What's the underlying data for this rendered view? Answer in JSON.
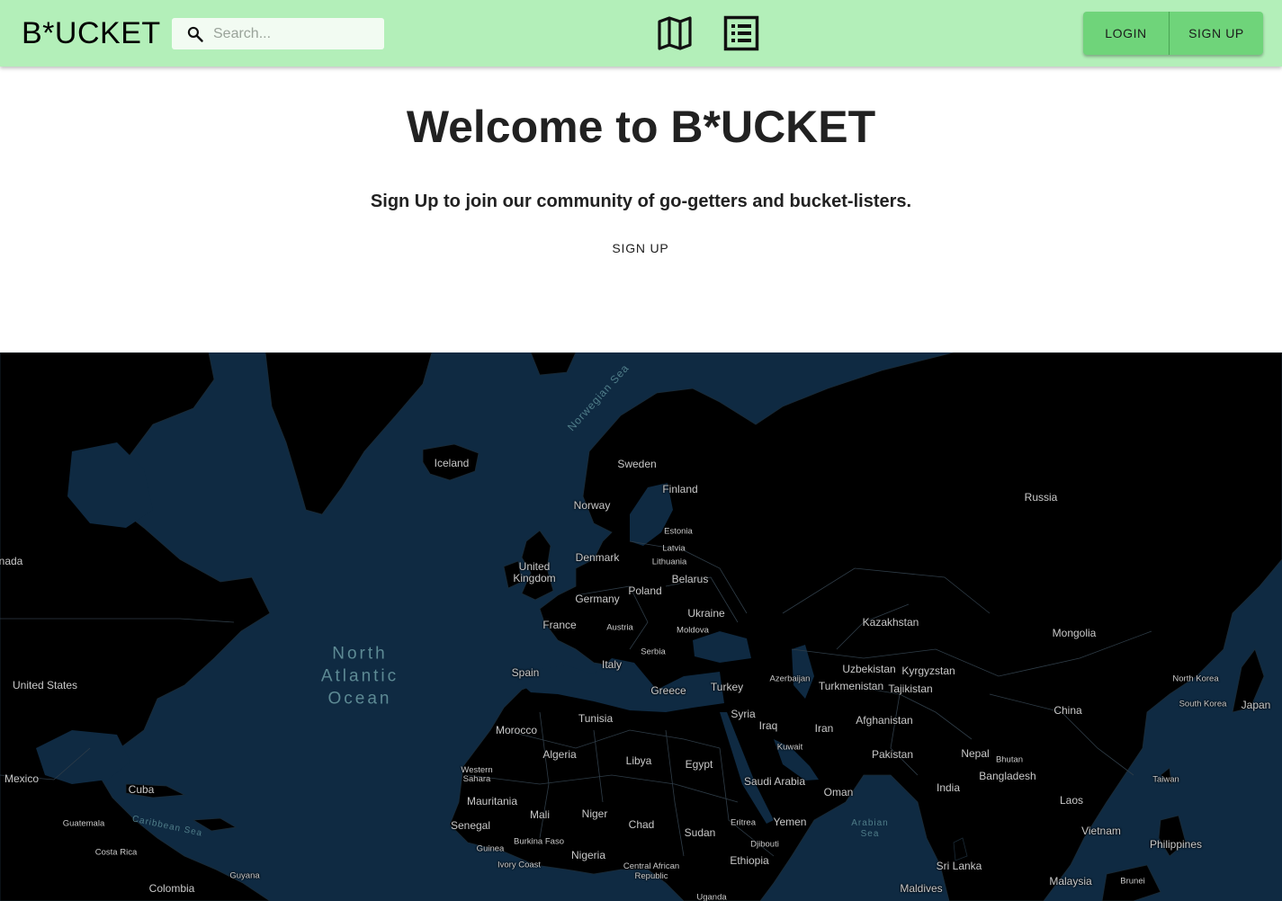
{
  "header": {
    "brand": "B*UCKET",
    "search": {
      "placeholder": "Search..."
    },
    "nav_icons": [
      "map-icon",
      "list-icon"
    ],
    "auth": {
      "login_label": "LOGIN",
      "signup_label": "SIGN UP"
    }
  },
  "hero": {
    "title": "Welcome to B*UCKET",
    "subtitle": "Sign Up to join our community of go-getters and bucket-listers.",
    "cta_label": "SIGN UP"
  },
  "map": {
    "oceans": {
      "north_atlantic": [
        "North",
        "Atlantic",
        "Ocean"
      ],
      "norwegian_sea": "Norwegian Sea",
      "caribbean_sea": "Caribbean Sea",
      "arabian_sea": [
        "Arabian",
        "Sea"
      ]
    },
    "countries": {
      "iceland": "Iceland",
      "sweden": "Sweden",
      "finland": "Finland",
      "norway": "Norway",
      "russia": "Russia",
      "estonia": "Estonia",
      "latvia": "Latvia",
      "lithuania": "Lithuania",
      "denmark": "Denmark",
      "uk": [
        "United",
        "Kingdom"
      ],
      "belarus": "Belarus",
      "poland": "Poland",
      "germany": "Germany",
      "canada": "nada",
      "ukraine": "Ukraine",
      "kazakhstan": "Kazakhstan",
      "mongolia": "Mongolia",
      "france": "France",
      "austria": "Austria",
      "moldova": "Moldova",
      "serbia": "Serbia",
      "italy": "Italy",
      "spain": "Spain",
      "greece": "Greece",
      "turkey": "Turkey",
      "azerbaijan": "Azerbaijan",
      "uzbekistan": "Uzbekistan",
      "kyrgyzstan": "Kyrgyzstan",
      "turkmenistan": "Turkmenistan",
      "tajikistan": "Tajikistan",
      "north_korea": "North Korea",
      "south_korea": "South Korea",
      "japan": "Japan",
      "united_states": "United States",
      "china": "China",
      "afghanistan": "Afghanistan",
      "syria": "Syria",
      "tunisia": "Tunisia",
      "iraq": "Iraq",
      "iran": "Iran",
      "morocco": "Morocco",
      "kuwait": "Kuwait",
      "algeria": "Algeria",
      "pakistan": "Pakistan",
      "nepal": "Nepal",
      "libya": "Libya",
      "egypt": "Egypt",
      "bhutan": "Bhutan",
      "western_sahara": [
        "Western",
        "Sahara"
      ],
      "bangladesh": "Bangladesh",
      "mexico": "Mexico",
      "saudi_arabia": "Saudi Arabia",
      "taiwan": "Taiwan",
      "india": "India",
      "cuba": "Cuba",
      "oman": "Oman",
      "mauritania": "Mauritania",
      "laos": "Laos",
      "mali": "Mali",
      "niger": "Niger",
      "guatemala": "Guatemala",
      "chad": "Chad",
      "eritrea": "Eritrea",
      "yemen": "Yemen",
      "senegal": "Senegal",
      "sudan": "Sudan",
      "vietnam": "Vietnam",
      "burkina_faso": "Burkina Faso",
      "djibouti": "Djibouti",
      "guinea": "Guinea",
      "costa_rica": "Costa Rica",
      "philippines": "Philippines",
      "nigeria": "Nigeria",
      "ethiopia": "Ethiopia",
      "ivory_coast": "Ivory Coast",
      "car": [
        "Central African",
        "Republic"
      ],
      "sri_lanka": "Sri Lanka",
      "guyana": "Guyana",
      "malaysia": "Malaysia",
      "brunei": "Brunei",
      "colombia": "Colombia",
      "maldives": "Maldives",
      "uganda": "Uganda"
    }
  }
}
